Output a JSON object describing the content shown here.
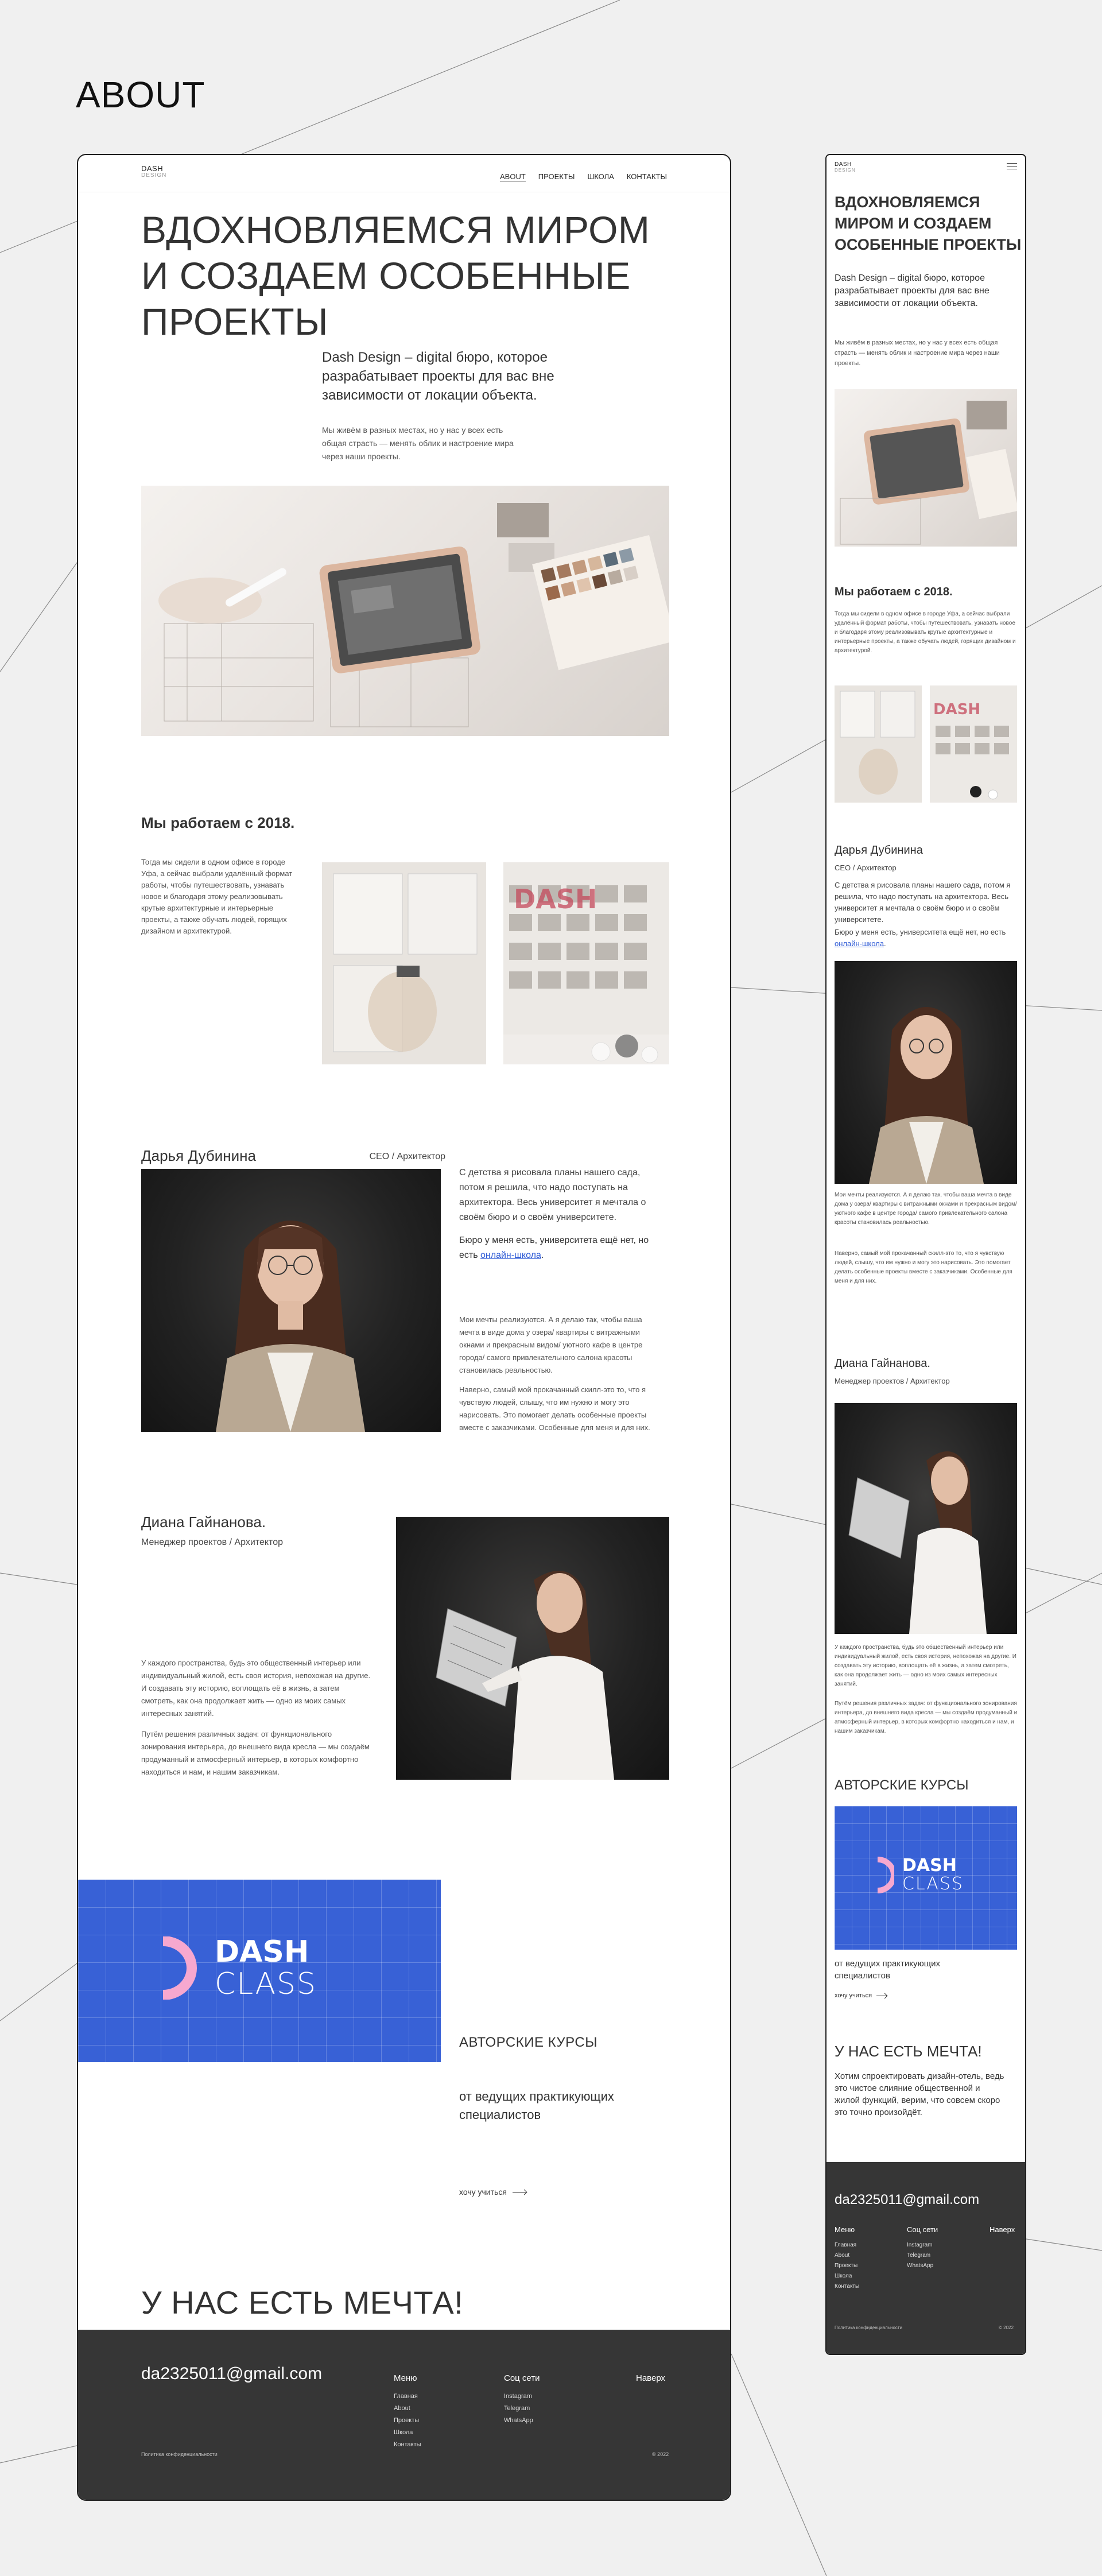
{
  "page_title": "ABOUT",
  "brand": {
    "name": "DASH",
    "sub": "DESIGN"
  },
  "nav": {
    "about": "ABOUT",
    "projects": "ПРОЕКТЫ",
    "school": "ШКОЛА",
    "contacts": "КОНТАКТЫ"
  },
  "hero": {
    "heading": "ВДОХНОВЛЯЕМСЯ МИРОМ И СОЗДАЕМ ОСОБЕННЫЕ ПРОЕКТЫ",
    "lead": "Dash Design – digital бюро, которое разрабатывает проекты для вас вне зависимости от локации объекта.",
    "small": "Мы живём в разных местах, но у нас у всех есть общая страсть — менять облик и настроение мира через наши проекты."
  },
  "work": {
    "heading": "Мы работаем с 2018.",
    "text": "Тогда мы сидели в одном офисе в городе Уфа, а сейчас выбрали удалённый формат работы, чтобы путешествовать, узнавать новое и благодаря этому реализовывать крутые архитектурные и интерьерные проекты, а также обучать людей, горящих дизайном и архитектурой."
  },
  "person1": {
    "name": "Дарья Дубинина",
    "role": "CEO / Архитектор",
    "p1": "С детства я рисовала планы нашего сада, потом я решила, что надо поступать на архитектора. Весь университет я мечтала о своём бюро и о своём университете.",
    "p2_before": "Бюро у меня есть, университета ещё нет, но есть ",
    "p2_link": "онлайн-школа",
    "p2_after": ".",
    "p3": "Мои мечты реализуются. А я делаю так, чтобы ваша мечта в виде дома у озера/ квартиры с витражными окнами и прекрасным видом/ уютного кафе в центре города/ самого привлекательного салона красоты становилась реальностью.",
    "p4": "Наверно, самый мой прокачанный скилл-это то, что я чувствую людей, слышу, что им нужно и могу это нарисовать. Это помогает делать особенные проекты вместе с заказчиками. Особенные для меня и для них."
  },
  "person2": {
    "name": "Диана Гайнанова.",
    "role": "Менеджер проектов / Архитектор",
    "p1": "У каждого пространства, будь это общественный интерьер или индивидуальный жилой, есть своя история, непохожая на другие. И создавать эту историю, воплощать её в жизнь, а затем смотреть, как она продолжает жить — одно из моих самых интересных занятий.",
    "p2": "Путём решения различных задач: от функционального зонирования интерьера, до внешнего вида кресла — мы создаём продуманный и атмосферный интерьер, в которых комфортно находиться и нам, и нашим заказчикам."
  },
  "courses": {
    "heading": "АВТОРСКИЕ КУРСЫ",
    "text": "от ведущих практикующих специалистов",
    "link": "хочу учиться",
    "logo_word1": "DASH",
    "logo_word2": "CLASS"
  },
  "dream": {
    "heading": "У НАС ЕСТЬ МЕЧТА!",
    "text": "Хотим спроектировать дизайн-отель, ведь это чистое слияние общественной и жилой функций, верим, что совсем скоро это точно произойдёт."
  },
  "footer": {
    "email": "da2325011@gmail.com",
    "menu_heading": "Меню",
    "menu": [
      "Главная",
      "About",
      "Проекты",
      "Школа",
      "Контакты"
    ],
    "social_heading": "Соц сети",
    "social": [
      "Instagram",
      "Telegram",
      "WhatsApp"
    ],
    "top": "Наверх",
    "privacy": "Политика конфиденциальности",
    "year": "© 2022"
  },
  "colors": {
    "background": "#f0f0f0",
    "banner_blue": "#3861d6",
    "logo_pink": "#f7a8cf",
    "footer": "#363636",
    "link": "#2f5bd6"
  }
}
